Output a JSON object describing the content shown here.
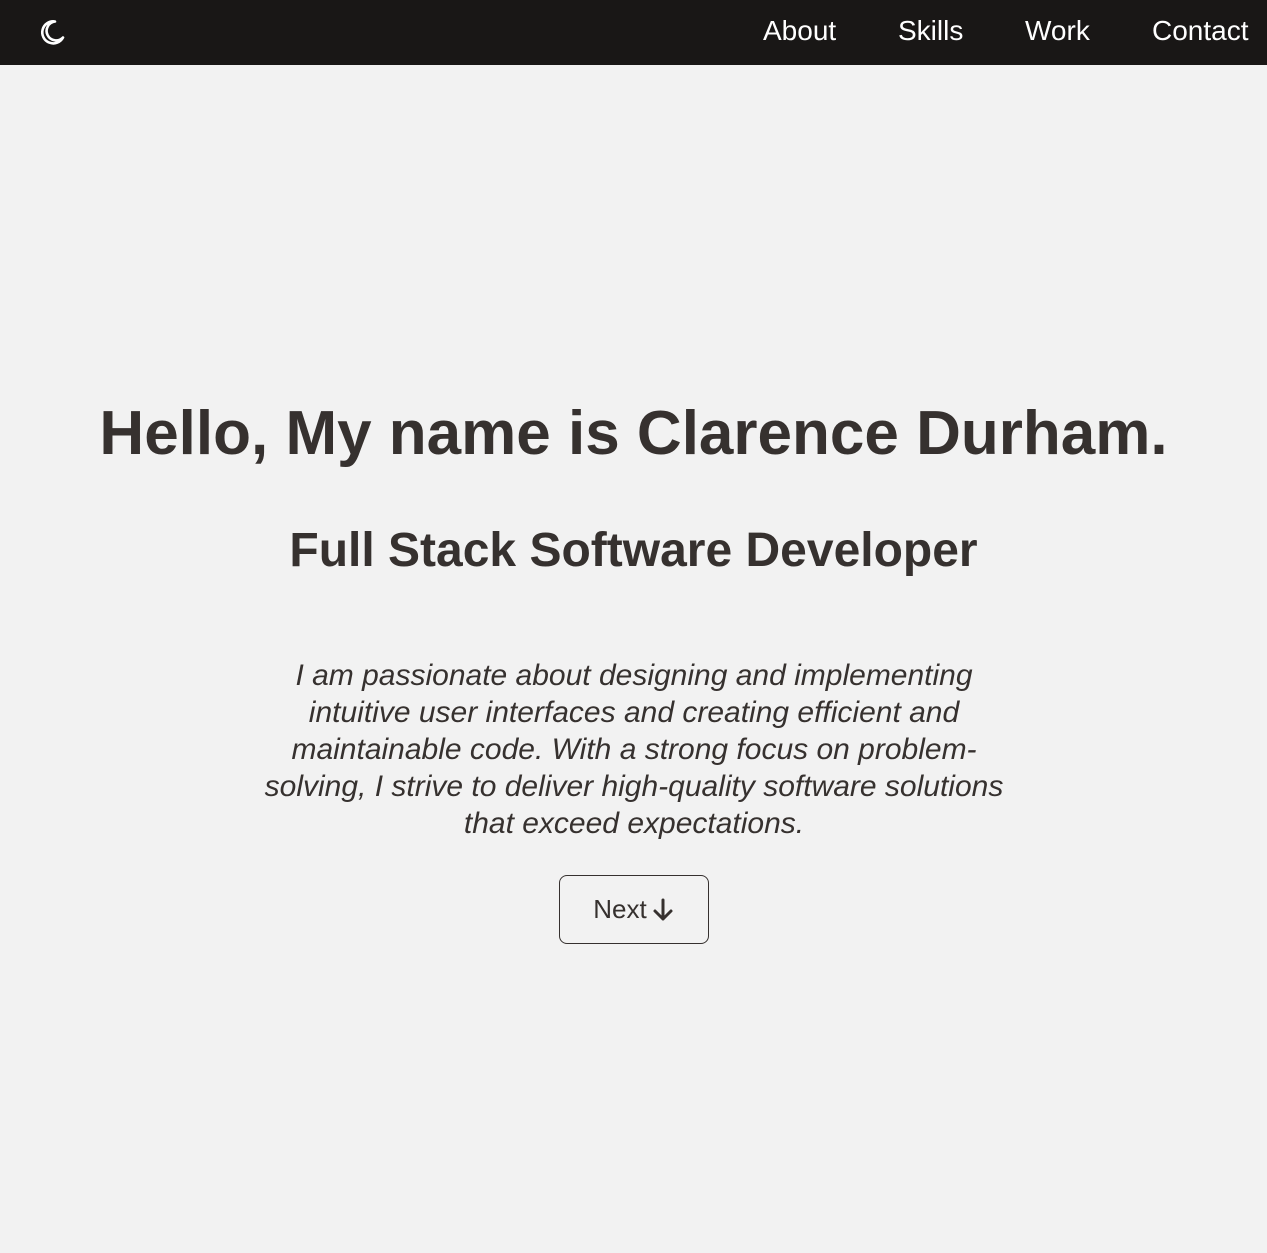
{
  "nav": {
    "theme_icon": "moon-icon",
    "links": [
      {
        "label": "About"
      },
      {
        "label": "Skills"
      },
      {
        "label": "Work"
      },
      {
        "label": "Contact"
      }
    ]
  },
  "hero": {
    "title": "Hello, My name is Clarence Durham.",
    "subtitle": "Full Stack Software Developer",
    "description": "I am passionate about designing and implementing intuitive user interfaces and creating efficient and maintainable code. With a strong focus on problem-solving, I strive to deliver high-quality software solutions that exceed expectations.",
    "next_label": "Next",
    "next_icon": "arrow-down-icon"
  },
  "colors": {
    "navbar_bg": "#191716",
    "page_bg": "#f2f2f2",
    "text": "#36312f",
    "nav_text": "#ffffff"
  }
}
